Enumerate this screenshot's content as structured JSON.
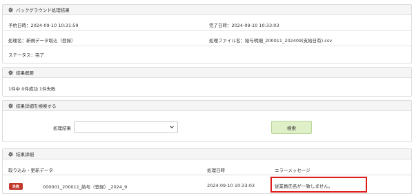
{
  "background_panel": {
    "title": "バックグラウンド処理結果",
    "scheduled_label": "予約日時：2024-09-10 10:31:59",
    "completed_label": "完了日時：2024-09-10 10:33:03",
    "process_name_label": "処理名：新規データ取込（登録）",
    "process_file_label": "処理ファイル名：給与明細_200011_202409(支給日有).csv",
    "status_label": "ステータス：完了"
  },
  "summary_panel": {
    "title": "結果概要",
    "summary_text": "1件中 0件成功 1件失敗"
  },
  "search_panel": {
    "title": "結果詳細を検索する",
    "result_label": "処理結果",
    "result_select_value": "",
    "search_button_label": "検索"
  },
  "detail_panel": {
    "title": "結果詳細",
    "columns": [
      "取り込み・更新データ",
      "処理日時",
      "エラーメッセージ"
    ],
    "rows": [
      {
        "badge": "失敗",
        "data": "000001_200011_給与（登録）_2024_9",
        "processed_at": "2024-09-10 10:33:03",
        "error": "従業員氏名が一致しません。"
      }
    ]
  },
  "colors": {
    "panel_header_bg": "#f5f5f5",
    "search_button_bg": "#dff0c8",
    "fail_badge": "#c0392b",
    "highlight_border": "#e01b1b"
  },
  "icons": {
    "panel_icon": "gear-icon",
    "select_icon": "chevron-down-icon"
  }
}
